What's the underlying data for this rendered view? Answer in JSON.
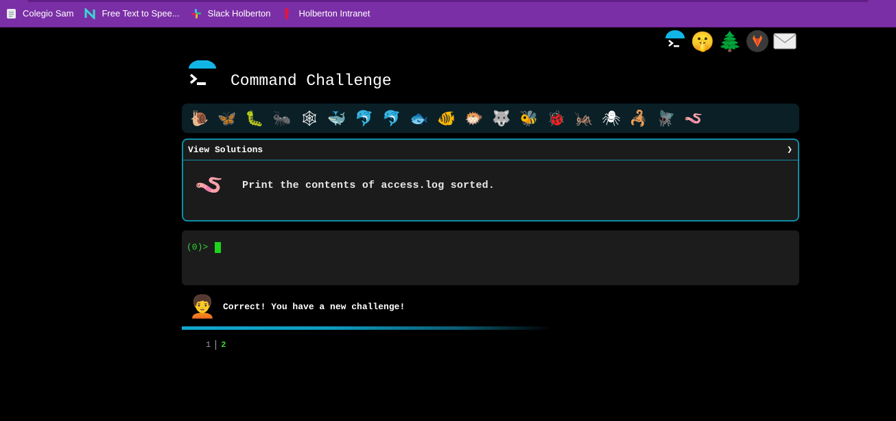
{
  "bookmarks": [
    {
      "label": "Colegio Sam",
      "icon": "page-icon"
    },
    {
      "label": "Free Text to Spee...",
      "icon": "n-logo-icon"
    },
    {
      "label": "Slack Holberton",
      "icon": "slack-icon"
    },
    {
      "label": "Holberton Intranet",
      "icon": "holberton-icon"
    }
  ],
  "top_icons": [
    "terminal-icon",
    "shushing-face-icon",
    "tree-icon",
    "gitlab-icon",
    "envelope-icon"
  ],
  "header": {
    "title": "Command Challenge"
  },
  "animals": [
    "🐌",
    "🦋",
    "🐛",
    "🐜",
    "🕸",
    "🐳",
    "🐬",
    "🐬",
    "🐟",
    "🐠",
    "🐡",
    "🐺",
    "🐝",
    "🐞",
    "🦗",
    "🕷",
    "🦂",
    "🪰",
    "🪱"
  ],
  "challenge": {
    "solutions_label": "View Solutions",
    "chevron": "❯",
    "prompt_emoji": "🪱",
    "text": "Print the contents of access.log sorted."
  },
  "terminal": {
    "prompt": "(0)>"
  },
  "result": {
    "avatar": "🧑‍🦱",
    "message": "Correct! You have a new challenge!"
  },
  "counter": {
    "completed": "1",
    "current": "2"
  },
  "colors": {
    "bookmark_bar": "#7b2fa6",
    "accent": "#0f8fa8",
    "prompt_green": "#33d632"
  }
}
